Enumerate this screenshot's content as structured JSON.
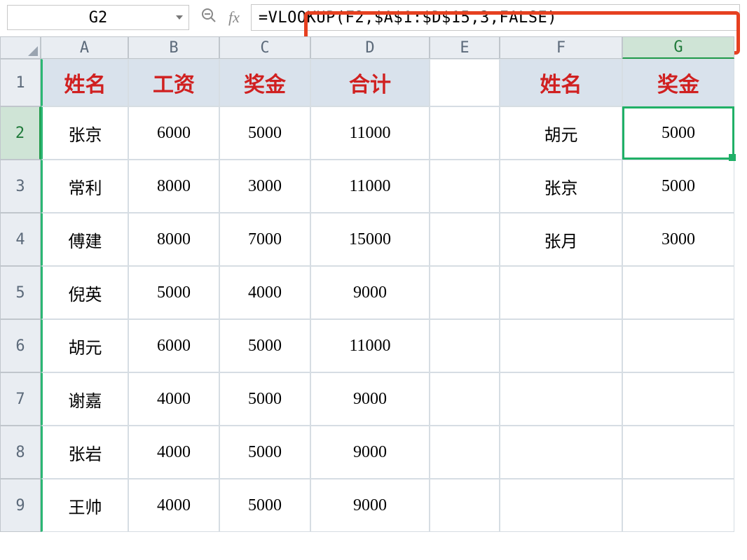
{
  "formula_bar": {
    "cell_reference": "G2",
    "fx_label": "fx",
    "formula": "=VLOOKUP(F2,$A$1:$D$15,3,FALSE)"
  },
  "columns": [
    "A",
    "B",
    "C",
    "D",
    "E",
    "F",
    "G"
  ],
  "rows": [
    "1",
    "2",
    "3",
    "4",
    "5",
    "6",
    "7",
    "8",
    "9"
  ],
  "headers_main": {
    "A": "姓名",
    "B": "工资",
    "C": "奖金",
    "D": "合计"
  },
  "headers_right": {
    "F": "姓名",
    "G": "奖金"
  },
  "data_main": [
    {
      "A": "张京",
      "B": "6000",
      "C": "5000",
      "D": "11000"
    },
    {
      "A": "常利",
      "B": "8000",
      "C": "3000",
      "D": "11000"
    },
    {
      "A": "傅建",
      "B": "8000",
      "C": "7000",
      "D": "15000"
    },
    {
      "A": "倪英",
      "B": "5000",
      "C": "4000",
      "D": "9000"
    },
    {
      "A": "胡元",
      "B": "6000",
      "C": "5000",
      "D": "11000"
    },
    {
      "A": "谢嘉",
      "B": "4000",
      "C": "5000",
      "D": "9000"
    },
    {
      "A": "张岩",
      "B": "4000",
      "C": "5000",
      "D": "9000"
    },
    {
      "A": "王帅",
      "B": "4000",
      "C": "5000",
      "D": "9000"
    }
  ],
  "data_right": [
    {
      "F": "胡元",
      "G": "5000"
    },
    {
      "F": "张京",
      "G": "5000"
    },
    {
      "F": "张月",
      "G": "3000"
    }
  ],
  "active_cell": "G2"
}
